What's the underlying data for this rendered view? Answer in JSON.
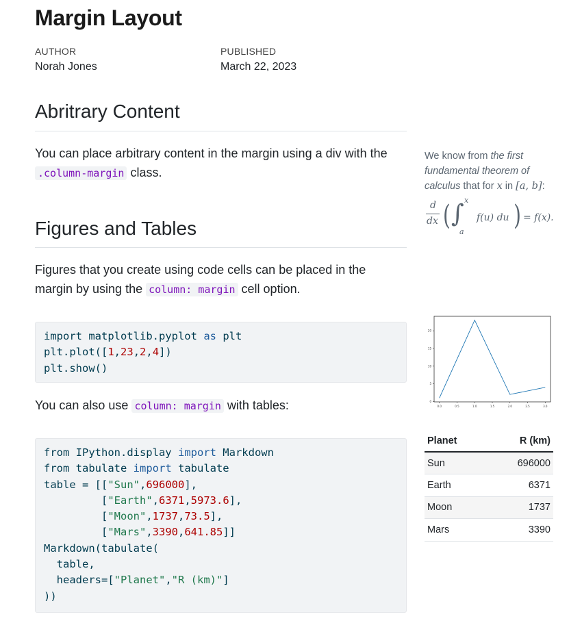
{
  "header": {
    "title": "Margin Layout",
    "author_label": "AUTHOR",
    "author": "Norah Jones",
    "published_label": "PUBLISHED",
    "published": "March 22, 2023"
  },
  "sections": {
    "arbitrary": {
      "heading": "Abritrary Content",
      "text_before": "You can place arbitrary content in the margin using a div with the",
      "code": ".column-margin",
      "text_after": " class."
    },
    "figures": {
      "heading": "Figures and Tables",
      "text_line1": "Figures that you create using code cells can be placed in the",
      "text_before": "margin by using the ",
      "code": "column: margin",
      "text_after": " cell option.",
      "code1": {
        "line1_a": "import",
        "line1_b": " matplotlib.pyplot ",
        "line1_c": "as",
        "line1_d": " plt",
        "line2_a": "plt.plot([",
        "line2_n1": "1",
        "line2_n2": "23",
        "line2_n3": "2",
        "line2_n4": "4",
        "line2_b": "])",
        "line3": "plt.show()"
      },
      "tables_text_before": "You can also use ",
      "tables_code": "column: margin",
      "tables_text_after": " with tables:",
      "code2": {
        "l1_a": "from",
        "l1_b": " IPython.display ",
        "l1_c": "import",
        "l1_d": " Markdown",
        "l2_a": "from",
        "l2_b": " tabulate ",
        "l2_c": "import",
        "l2_d": " tabulate",
        "l3_a": "table = [[",
        "l3_s": "\"Sun\"",
        "l3_n": "696000",
        "l3_b": "],",
        "l4_s": "\"Earth\"",
        "l4_n1": "6371",
        "l4_n2": "5973.6",
        "l5_s": "\"Moon\"",
        "l5_n1": "1737",
        "l5_n2": "73.5",
        "l6_s": "\"Mars\"",
        "l6_n1": "3390",
        "l6_n2": "641.85",
        "l7": "Markdown(tabulate(",
        "l8": "  table,",
        "l9_a": "  headers=[",
        "l9_s1": "\"Planet\"",
        "l9_s2": "\"R (km)\"",
        "l9_b": "]",
        "l10": "))"
      }
    }
  },
  "margin": {
    "note_a": "We know from ",
    "note_em": "the first fundamental theorem of calculus",
    "note_b": " that for ",
    "note_x": "x",
    "note_c": " in ",
    "note_interval": "[a, b]",
    "note_d": ":",
    "equation": {
      "d": "d",
      "dx": "dx",
      "upper": "x",
      "lower": "a",
      "integrand": "f(u) du",
      "rhs": "= f(x)."
    },
    "table": {
      "headers": [
        "Planet",
        "R (km)"
      ],
      "rows": [
        [
          "Sun",
          "696000"
        ],
        [
          "Earth",
          "6371"
        ],
        [
          "Moon",
          "1737"
        ],
        [
          "Mars",
          "3390"
        ]
      ]
    }
  },
  "chart_data": {
    "type": "line",
    "x": [
      0,
      1,
      2,
      3
    ],
    "y": [
      1,
      23,
      2,
      4
    ],
    "xlim": [
      -0.15,
      3.15
    ],
    "ylim": [
      -0.1,
      24.1
    ],
    "xticks": [
      "0.0",
      "0.5",
      "1.0",
      "1.5",
      "2.0",
      "2.5",
      "3.0"
    ],
    "yticks": [
      "0",
      "5",
      "10",
      "15",
      "20"
    ],
    "line_color": "#1f77b4"
  }
}
